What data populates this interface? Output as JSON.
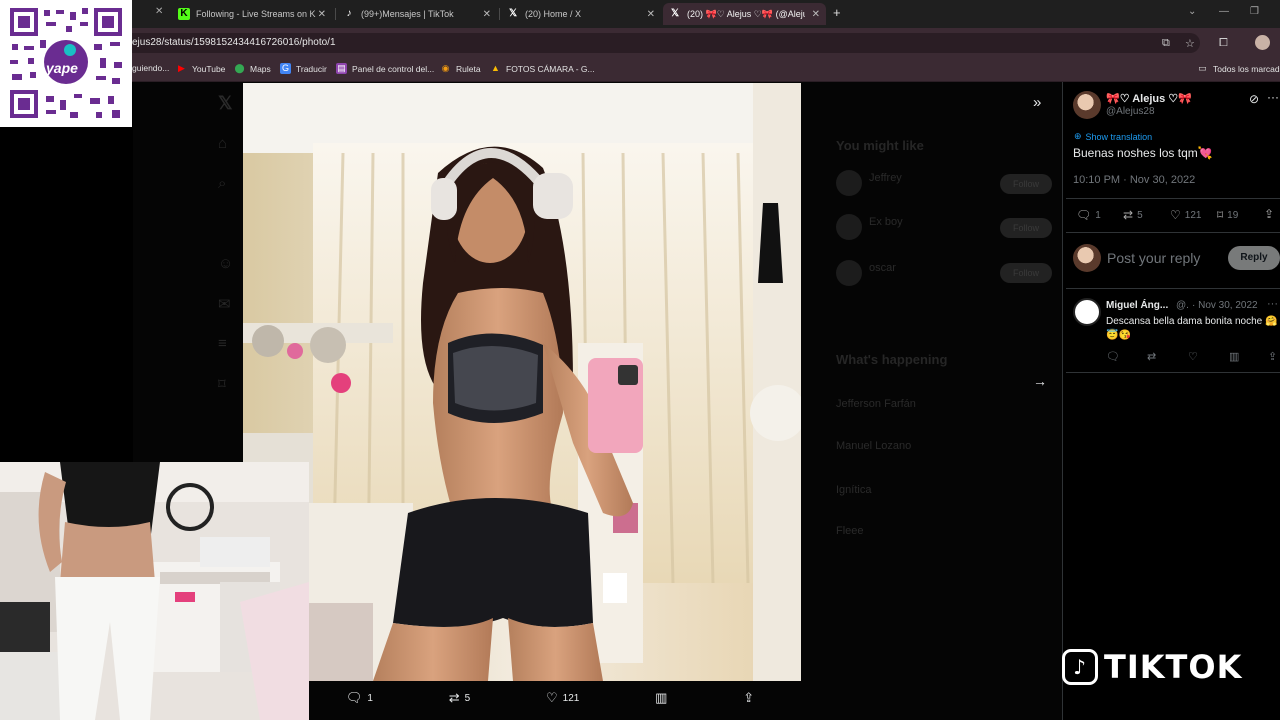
{
  "browser": {
    "tabs": [
      {
        "title": "Following - Live Streams on Ki",
        "icon": "kick-icon",
        "color": "#53fc18"
      },
      {
        "title": "(99+)Mensajes | TikTok",
        "icon": "tiktok-icon",
        "color": "#ffffff"
      },
      {
        "title": "(20) Home / X",
        "icon": "x-icon",
        "color": "#ffffff"
      },
      {
        "title": "(20) 🎀♡ Alejus ♡🎀 (@Alejus2",
        "icon": "x-icon",
        "color": "#ffffff"
      }
    ],
    "url": "ejus28/status/1598152434416726016/photo/1",
    "bookmarks": [
      {
        "label": "guiendo...",
        "icon": "folder-icon"
      },
      {
        "label": "YouTube",
        "icon": "youtube-icon",
        "color": "#ff0000"
      },
      {
        "label": "Maps",
        "icon": "maps-icon",
        "color": "#34a853"
      },
      {
        "label": "Traducir",
        "icon": "translate-icon",
        "color": "#4285f4"
      },
      {
        "label": "Panel de control del...",
        "icon": "panel-icon",
        "color": "#8e44ad"
      },
      {
        "label": "Ruleta",
        "icon": "roulette-icon",
        "color": "#f39c12"
      },
      {
        "label": "FOTOS CÁMARA - G...",
        "icon": "drive-icon",
        "color": "#fbbc04"
      }
    ],
    "all_bookmarks": "Todos los marcado"
  },
  "photo_actions": {
    "replies": "1",
    "reposts": "5",
    "likes": "121"
  },
  "tweet": {
    "display_name": "🎀♡ Alejus ♡🎀",
    "handle": "@Alejus28",
    "show_translation": "Show translation",
    "text": "Buenas noshes los tqm💘",
    "timestamp": "10:10 PM · Nov 30, 2022",
    "replies": "1",
    "reposts": "5",
    "likes": "121",
    "bookmarks": "19",
    "reply_placeholder": "Post your reply",
    "reply_button": "Reply"
  },
  "reply": {
    "name": "Miguel Áng...",
    "handle": "@.",
    "date": "· Nov 30, 2022",
    "text": "Descansa bella dama bonita noche 🤗😇😘"
  },
  "sidebar_dim": {
    "you_might_like": "You might like",
    "whats_happening": "What's happening",
    "suggestions": [
      "Jeffrey",
      "Ex boy",
      "oscar"
    ],
    "follow": "Follow",
    "trends": [
      "Jefferson Farfán",
      "Manuel Lozano",
      "Ignítica",
      "Fleee"
    ]
  },
  "overlay": {
    "tiktok_label": "TIKTOK",
    "qr_brand": "yape"
  }
}
